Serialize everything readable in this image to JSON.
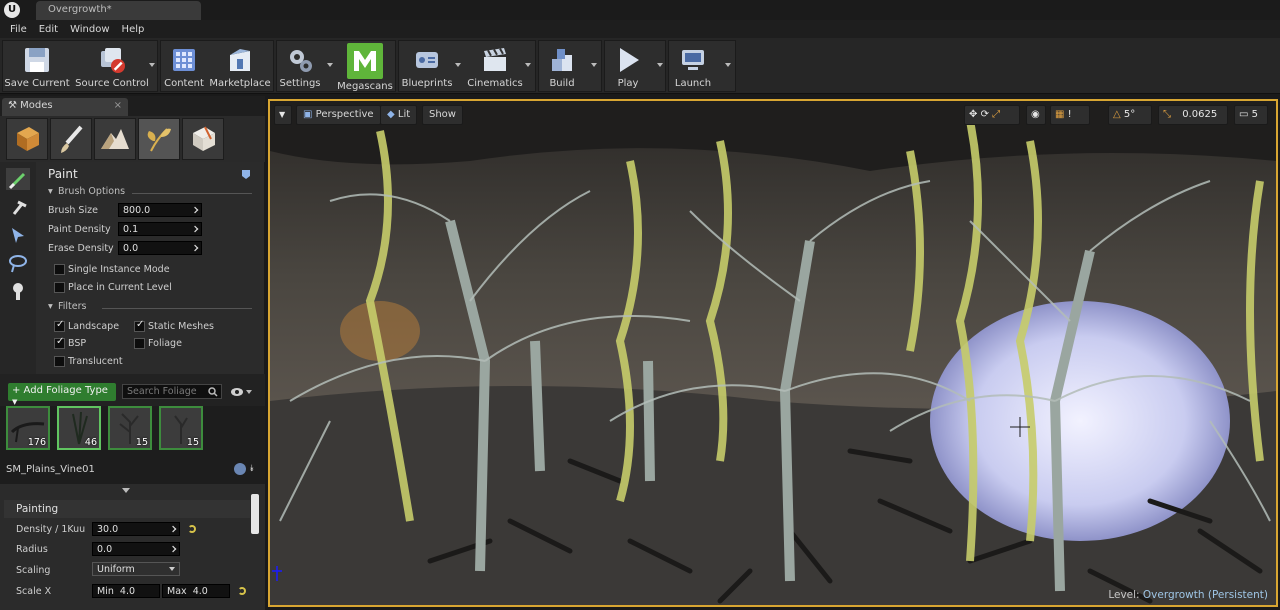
{
  "window": {
    "document_tab": "Overgrowth*"
  },
  "menu": [
    "File",
    "Edit",
    "Window",
    "Help"
  ],
  "toolbar": {
    "save": "Save Current",
    "source_control": "Source Control",
    "content": "Content",
    "marketplace": "Marketplace",
    "settings": "Settings",
    "megascans": "Megascans",
    "blueprints": "Blueprints",
    "cinematics": "Cinematics",
    "build": "Build",
    "play": "Play",
    "launch": "Launch"
  },
  "modes": {
    "tab_label": "Modes",
    "tab_close": "×",
    "panel_title": "Paint",
    "brush_options": {
      "header": "Brush Options",
      "brush_size_label": "Brush Size",
      "brush_size": "800.0",
      "paint_density_label": "Paint Density",
      "paint_density": "0.1",
      "erase_density_label": "Erase Density",
      "erase_density": "0.0",
      "single_instance": "Single Instance Mode",
      "place_current_level": "Place in Current Level"
    },
    "filters": {
      "header": "Filters",
      "landscape": "Landscape",
      "static_meshes": "Static Meshes",
      "bsp": "BSP",
      "foliage": "Foliage",
      "translucent": "Translucent"
    }
  },
  "foliage": {
    "add_button": "+ Add Foliage Type",
    "search_placeholder": "Search Foliage",
    "thumbs": [
      {
        "count": "176"
      },
      {
        "count": "46"
      },
      {
        "count": "15"
      },
      {
        "count": "15"
      }
    ],
    "selected_mesh": "SM_Plains_Vine01"
  },
  "painting": {
    "header": "Painting",
    "density_label": "Density / 1Kuu",
    "density": "30.0",
    "radius_label": "Radius",
    "radius": "0.0",
    "scaling_label": "Scaling",
    "scaling": "Uniform",
    "scale_x_label": "Scale X",
    "min_label": "Min",
    "min": "4.0",
    "max_label": "Max",
    "max": "4.0"
  },
  "viewport": {
    "perspective": "Perspective",
    "lit": "Lit",
    "show": "Show",
    "angle_snap": "5°",
    "scale_snap": "0.0625",
    "camera_speed": "5",
    "level_label": "Level:",
    "level_name": "Overgrowth (Persistent)"
  }
}
